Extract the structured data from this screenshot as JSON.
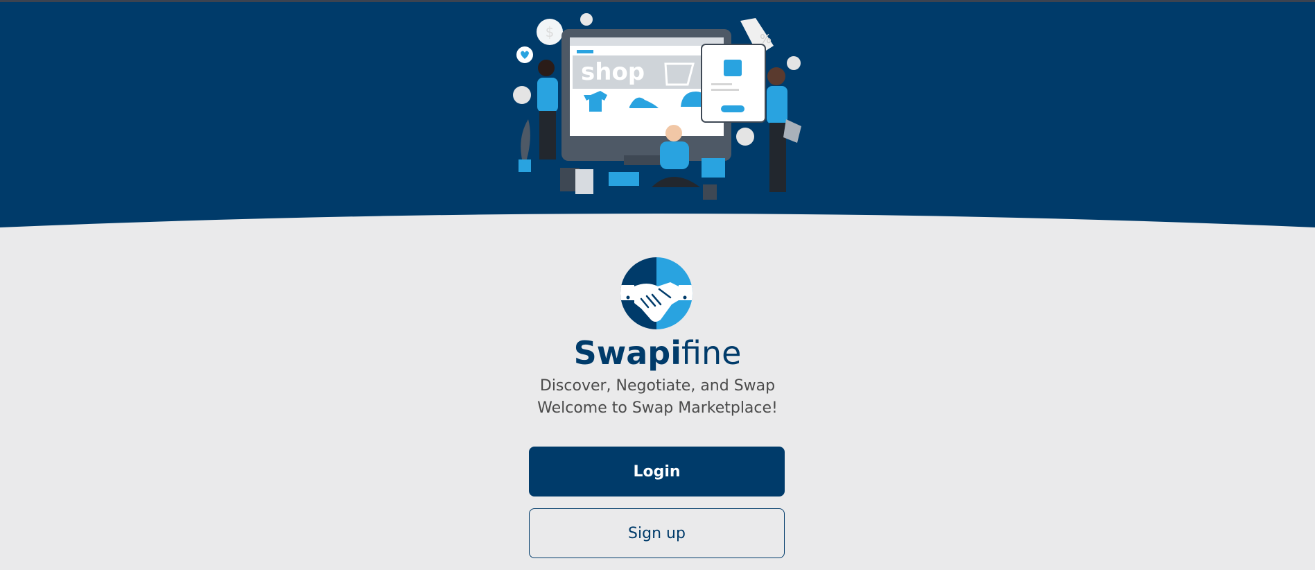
{
  "colors": {
    "primary": "#003b6a",
    "accent": "#29a3e0",
    "background": "#eaeaeb"
  },
  "hero": {
    "illustration": "online-shopping-illustration",
    "shop_sign": "shop"
  },
  "brand": {
    "logo": "handshake-icon",
    "name_bold": "Swapi",
    "name_light": "fine"
  },
  "tagline": {
    "line1": "Discover, Negotiate, and Swap",
    "line2": "Welcome to Swap Marketplace!"
  },
  "actions": {
    "login_label": "Login",
    "signup_label": "Sign up"
  }
}
